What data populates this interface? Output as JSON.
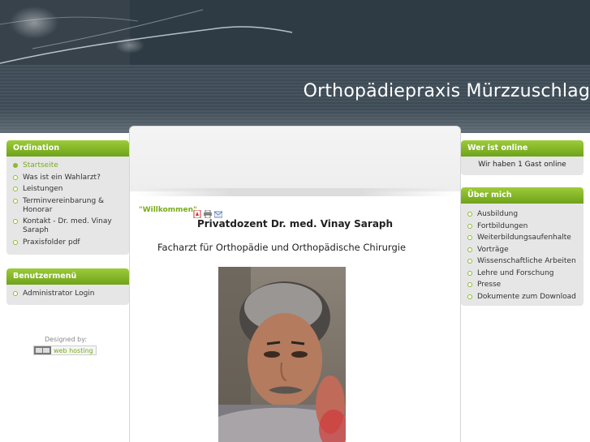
{
  "header": {
    "site_title": "Orthopädiepraxis Mürzzuschlag"
  },
  "left": {
    "ordination": {
      "heading": "Ordination",
      "items": [
        {
          "label": "Startseite"
        },
        {
          "label": "Was ist ein Wahlarzt?"
        },
        {
          "label": "Leistungen"
        },
        {
          "label": "Terminvereinbarung & Honorar"
        },
        {
          "label": "Kontakt - Dr. med. Vinay Saraph"
        },
        {
          "label": "Praxisfolder pdf"
        }
      ]
    },
    "benutzermenu": {
      "heading": "Benutzermenü",
      "items": [
        {
          "label": "Administrator Login"
        }
      ]
    },
    "designed_by": {
      "label": "Designed by:",
      "link": "web hosting"
    }
  },
  "main": {
    "article_title": "\"Willkommen\"",
    "doctor_name": "Privatdozent Dr. med. Vinay Saraph",
    "specialty": "Facharzt für Orthopädie und Orthopädische Chirurgie"
  },
  "right": {
    "online": {
      "heading": "Wer ist online",
      "text": "Wir haben 1 Gast online"
    },
    "ueber": {
      "heading": "Über mich",
      "items": [
        {
          "label": "Ausbildung"
        },
        {
          "label": "Fortbildungen"
        },
        {
          "label": "Weiterbildungsaufenhalte"
        },
        {
          "label": "Vorträge"
        },
        {
          "label": "Wissenschaftliche Arbeiten"
        },
        {
          "label": "Lehre und Forschung"
        },
        {
          "label": "Presse"
        },
        {
          "label": "Dokumente zum Download"
        }
      ]
    }
  },
  "colors": {
    "accent": "#8cbb2a",
    "header": "#3e4b55"
  },
  "icons": [
    "pdf-icon",
    "print-icon",
    "email-icon",
    "web-hosting-logo"
  ]
}
